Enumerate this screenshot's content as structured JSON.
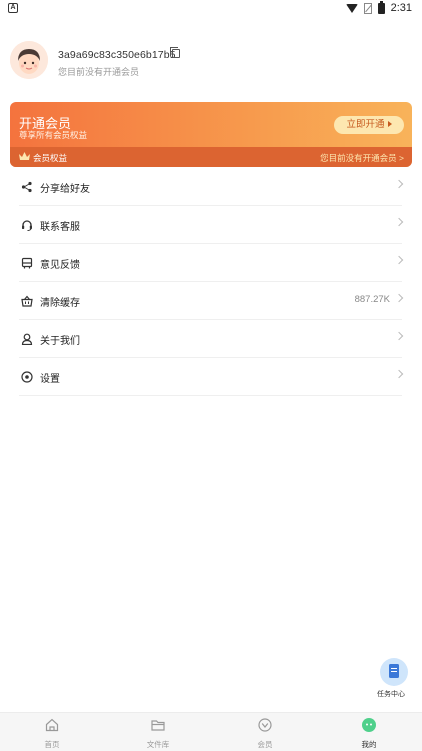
{
  "status_bar": {
    "time": "2:31",
    "app_icon_letter": "A"
  },
  "profile": {
    "user_id": "3a9a69c83c350e6b17b5",
    "subtitle": "您目前没有开通会员"
  },
  "vip_card": {
    "title": "开通会员",
    "subtitle": "尊享所有会员权益",
    "button_label": "立即开通",
    "benefits_label": "会员权益",
    "status_text": "您目前没有开通会员 >",
    "colors": {
      "gradient_start": "#f4733e",
      "gradient_end": "#f8b35a",
      "button_bg": "#fde7b0"
    }
  },
  "menu": {
    "items": [
      {
        "label": "分享给好友",
        "icon": "share-icon",
        "value": ""
      },
      {
        "label": "联系客服",
        "icon": "headset-icon",
        "value": ""
      },
      {
        "label": "意见反馈",
        "icon": "feedback-icon",
        "value": ""
      },
      {
        "label": "清除缓存",
        "icon": "basket-icon",
        "value": "887.27K"
      },
      {
        "label": "关于我们",
        "icon": "person-icon",
        "value": ""
      },
      {
        "label": "设置",
        "icon": "settings-icon",
        "value": ""
      }
    ]
  },
  "task_center": {
    "label": "任务中心"
  },
  "bottom_nav": {
    "items": [
      {
        "label": "首页",
        "icon": "home-icon",
        "active": false
      },
      {
        "label": "文件库",
        "icon": "folder-icon",
        "active": false
      },
      {
        "label": "会员",
        "icon": "vip-icon",
        "active": false
      },
      {
        "label": "我的",
        "icon": "profile-icon",
        "active": true
      }
    ],
    "active_color": "#4fd08b"
  }
}
